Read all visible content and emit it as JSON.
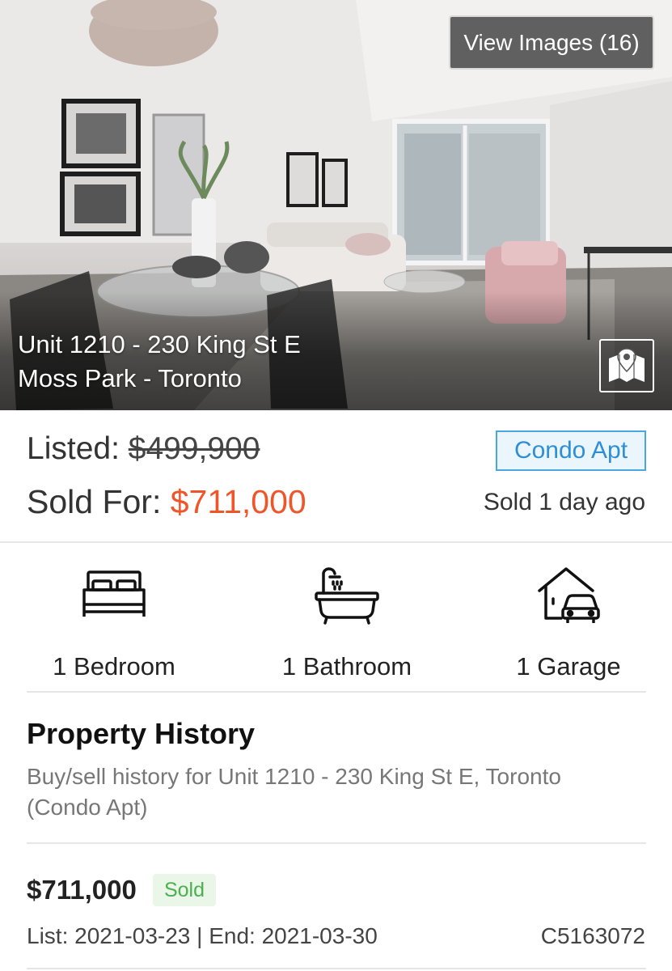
{
  "hero": {
    "view_images_label": "View Images (16)",
    "address_line1": "Unit 1210 - 230 King St E",
    "address_line2": "Moss Park - Toronto",
    "map_icon": "map-pin-icon"
  },
  "pricing": {
    "listed_label": "Listed: ",
    "listed_price": "$499,900",
    "sold_label": "Sold For: ",
    "sold_price": "$711,000",
    "property_type": "Condo Apt",
    "sold_ago": "Sold 1 day ago",
    "sold_price_color": "#f0552a",
    "type_badge_color": "#2f8fd6"
  },
  "features": [
    {
      "icon": "bed-icon",
      "label": "1 Bedroom"
    },
    {
      "icon": "bathtub-icon",
      "label": "1 Bathroom"
    },
    {
      "icon": "garage-icon",
      "label": "1 Garage"
    }
  ],
  "history": {
    "title": "Property History",
    "description": "Buy/sell history for Unit 1210 - 230 King St E, Toronto (Condo Apt)",
    "entries": [
      {
        "price": "$711,000",
        "status": "Sold",
        "dates": "List: 2021-03-23 | End: 2021-03-30",
        "mls": "C5163072",
        "status_color": "#4caf50"
      }
    ]
  }
}
